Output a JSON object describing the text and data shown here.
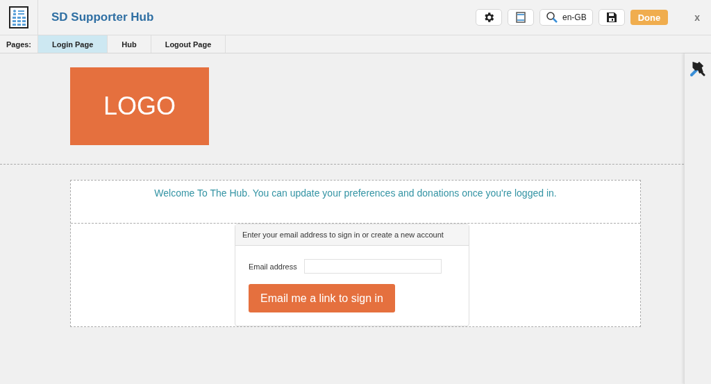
{
  "header": {
    "title": "SD Supporter Hub",
    "language": "en-GB",
    "done": "Done",
    "close": "x"
  },
  "pages": {
    "label": "Pages:",
    "tabs": [
      {
        "label": "Login Page",
        "selected": true
      },
      {
        "label": "Hub",
        "selected": false
      },
      {
        "label": "Logout Page",
        "selected": false
      }
    ]
  },
  "logo": {
    "text": "LOGO"
  },
  "welcome": "Welcome To The Hub. You can update your preferences and donations once you're logged in.",
  "login_card": {
    "heading": "Enter your email address to sign in or create a new account",
    "email_label": "Email address",
    "submit": "Email me a link to sign in"
  }
}
